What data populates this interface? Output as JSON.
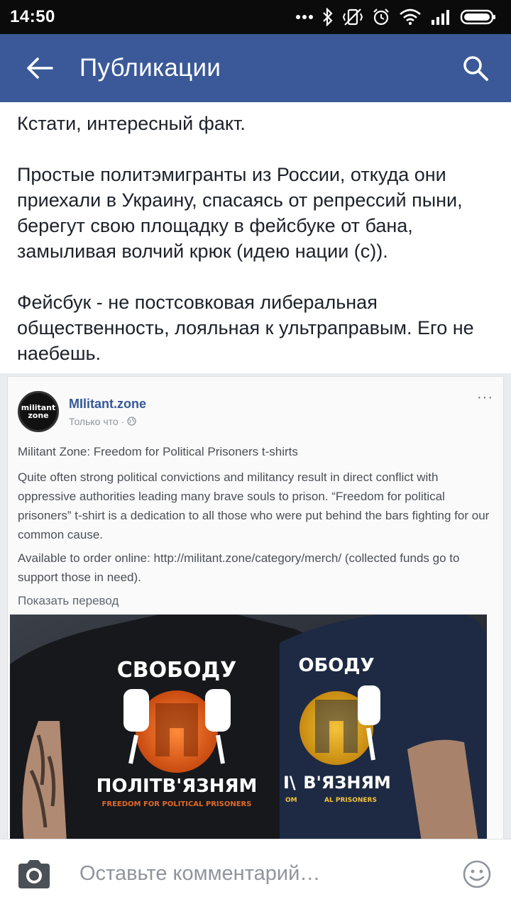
{
  "status_bar": {
    "time": "14:50",
    "icons": [
      "more-dots-icon",
      "bluetooth-icon",
      "vibrate-icon",
      "alarm-icon",
      "wifi-icon",
      "signal-icon",
      "battery-icon"
    ]
  },
  "app_bar": {
    "title": "Публикации",
    "back_icon": "arrow-left-icon",
    "search_icon": "search-icon",
    "color": "#3b5998"
  },
  "post": {
    "paragraphs": [
      "Кстати, интересный факт.",
      "Простые политэмигранты из России, откуда они приехали в Украину, спасаясь от репрессий пыни, берегут свою площадку в фейсбуке от бана, замыливая волчий крюк (идею нации (с)).",
      "Фейсбук - не постсовковая либеральная общественность, лояльная к ультраправым. Его не наебешь."
    ]
  },
  "embedded_screenshot": {
    "avatar_text": "militant zone",
    "page_name": "MIlitant.zone",
    "time": "Только что ·",
    "more": "···",
    "title": "Militant Zone: Freedom for Political Prisoners t-shirts",
    "body": "Quite often strong political convictions and militancy result in direct conflict with oppressive authorities leading many brave souls to prison. “Freedom for political prisoners” t-shirt is a dedication to all those who were put behind the bars fighting for our common cause.",
    "order_prefix": "Available to order online: ",
    "order_link": "http://militant.zone/category/merch/",
    "order_suffix": " (collected funds go to support those in need).",
    "translate": "Показать перевод",
    "shirt_left": {
      "top_text": "СВОБОДУ",
      "bottom_text": "ПОЛІТВ'ЯЗНЯМ",
      "sub_text": "FREEDOM FOR POLITICAL PRISONERS"
    },
    "shirt_right": {
      "top_text": "ОБОДУ",
      "bottom_text": "В'ЯЗНЯМ",
      "sub_text": "AL PRISONERS",
      "left_fragment": "I\\",
      "sub_left_fragment": "OM"
    }
  },
  "comment_bar": {
    "placeholder": "Оставьте комментарий…",
    "camera_icon": "camera-icon",
    "emoji_icon": "smiley-icon"
  }
}
